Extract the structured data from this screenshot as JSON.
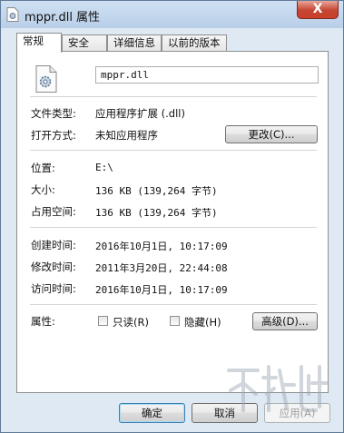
{
  "window": {
    "title": "mppr.dll 属性",
    "close_label": "X"
  },
  "tabs": [
    {
      "label": "常规",
      "active": true
    },
    {
      "label": "安全",
      "active": false
    },
    {
      "label": "详细信息",
      "active": false
    },
    {
      "label": "以前的版本",
      "active": false
    }
  ],
  "general": {
    "filename": "mppr.dll",
    "type_label": "文件类型:",
    "type_value": "应用程序扩展 (.dll)",
    "opens_with_label": "打开方式:",
    "opens_with_value": "未知应用程序",
    "change_button": "更改(C)...",
    "location_label": "位置:",
    "location_value": "E:\\",
    "size_label": "大小:",
    "size_value": "136 KB (139,264 字节)",
    "size_on_disk_label": "占用空间:",
    "size_on_disk_value": "136 KB (139,264 字节)",
    "created_label": "创建时间:",
    "created_value": "2016年10月1日, 10:17:09",
    "modified_label": "修改时间:",
    "modified_value": "2011年3月20日, 22:44:08",
    "accessed_label": "访问时间:",
    "accessed_value": "2016年10月1日, 10:17:09",
    "attributes_label": "属性:",
    "readonly_label": "只读(R)",
    "readonly_checked": false,
    "hidden_label": "隐藏(H)",
    "hidden_checked": false,
    "advanced_button": "高级(D)..."
  },
  "buttons": {
    "ok": "确定",
    "cancel": "取消",
    "apply": "应用(A)"
  },
  "icons": {
    "window": "dll-file-icon",
    "file": "dll-gear-file-icon",
    "close": "close-icon"
  },
  "colors": {
    "window_frame": "#dfe9f4",
    "close_button": "#c54532",
    "default_button_border": "#3c7fb1"
  }
}
